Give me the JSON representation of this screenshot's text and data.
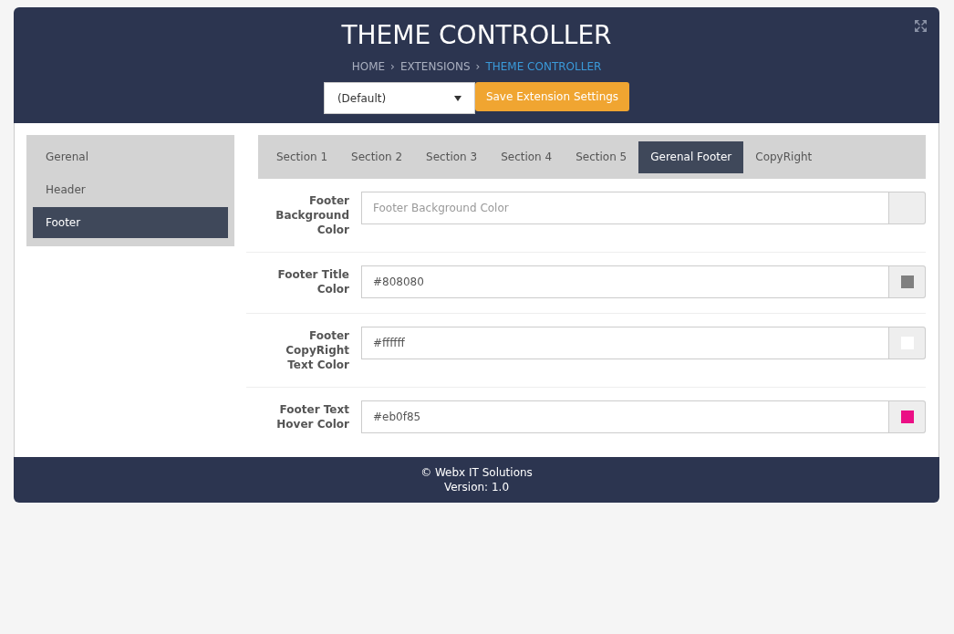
{
  "header": {
    "title": "THEME CONTROLLER",
    "breadcrumb": [
      {
        "kind": "link",
        "text": "HOME"
      },
      {
        "kind": "separator",
        "text": "›"
      },
      {
        "kind": "link",
        "text": "EXTENSIONS"
      },
      {
        "kind": "separator",
        "text": "›"
      },
      {
        "kind": "current",
        "text": "THEME CONTROLLER"
      }
    ],
    "theme_select": {
      "value": "(Default)"
    },
    "save_button": "Save Extension Settings"
  },
  "sidebar": {
    "items": [
      {
        "label": "Gerenal",
        "selected": false
      },
      {
        "label": "Header",
        "selected": false
      },
      {
        "label": "Footer",
        "selected": true
      }
    ]
  },
  "tabs": [
    {
      "label": "Section 1",
      "selected": false
    },
    {
      "label": "Section 2",
      "selected": false
    },
    {
      "label": "Section 3",
      "selected": false
    },
    {
      "label": "Section 4",
      "selected": false
    },
    {
      "label": "Section 5",
      "selected": false
    },
    {
      "label": "Gerenal Footer",
      "selected": true
    },
    {
      "label": "CopyRight",
      "selected": false
    }
  ],
  "fields": [
    {
      "label": "Footer Background Color",
      "placeholder": "Footer Background Color"
    },
    {
      "label": "Footer Title Color",
      "value": "#808080",
      "color": "#808080"
    },
    {
      "label": "Footer CopyRight Text Color",
      "value": "#ffffff",
      "color": "#ffffff"
    },
    {
      "label": "Footer Text Hover Color",
      "value": "#eb0f85",
      "color": "#eb0f85"
    }
  ],
  "footer": {
    "copyright": "© Webx IT Solutions",
    "version": "Version: 1.0"
  }
}
